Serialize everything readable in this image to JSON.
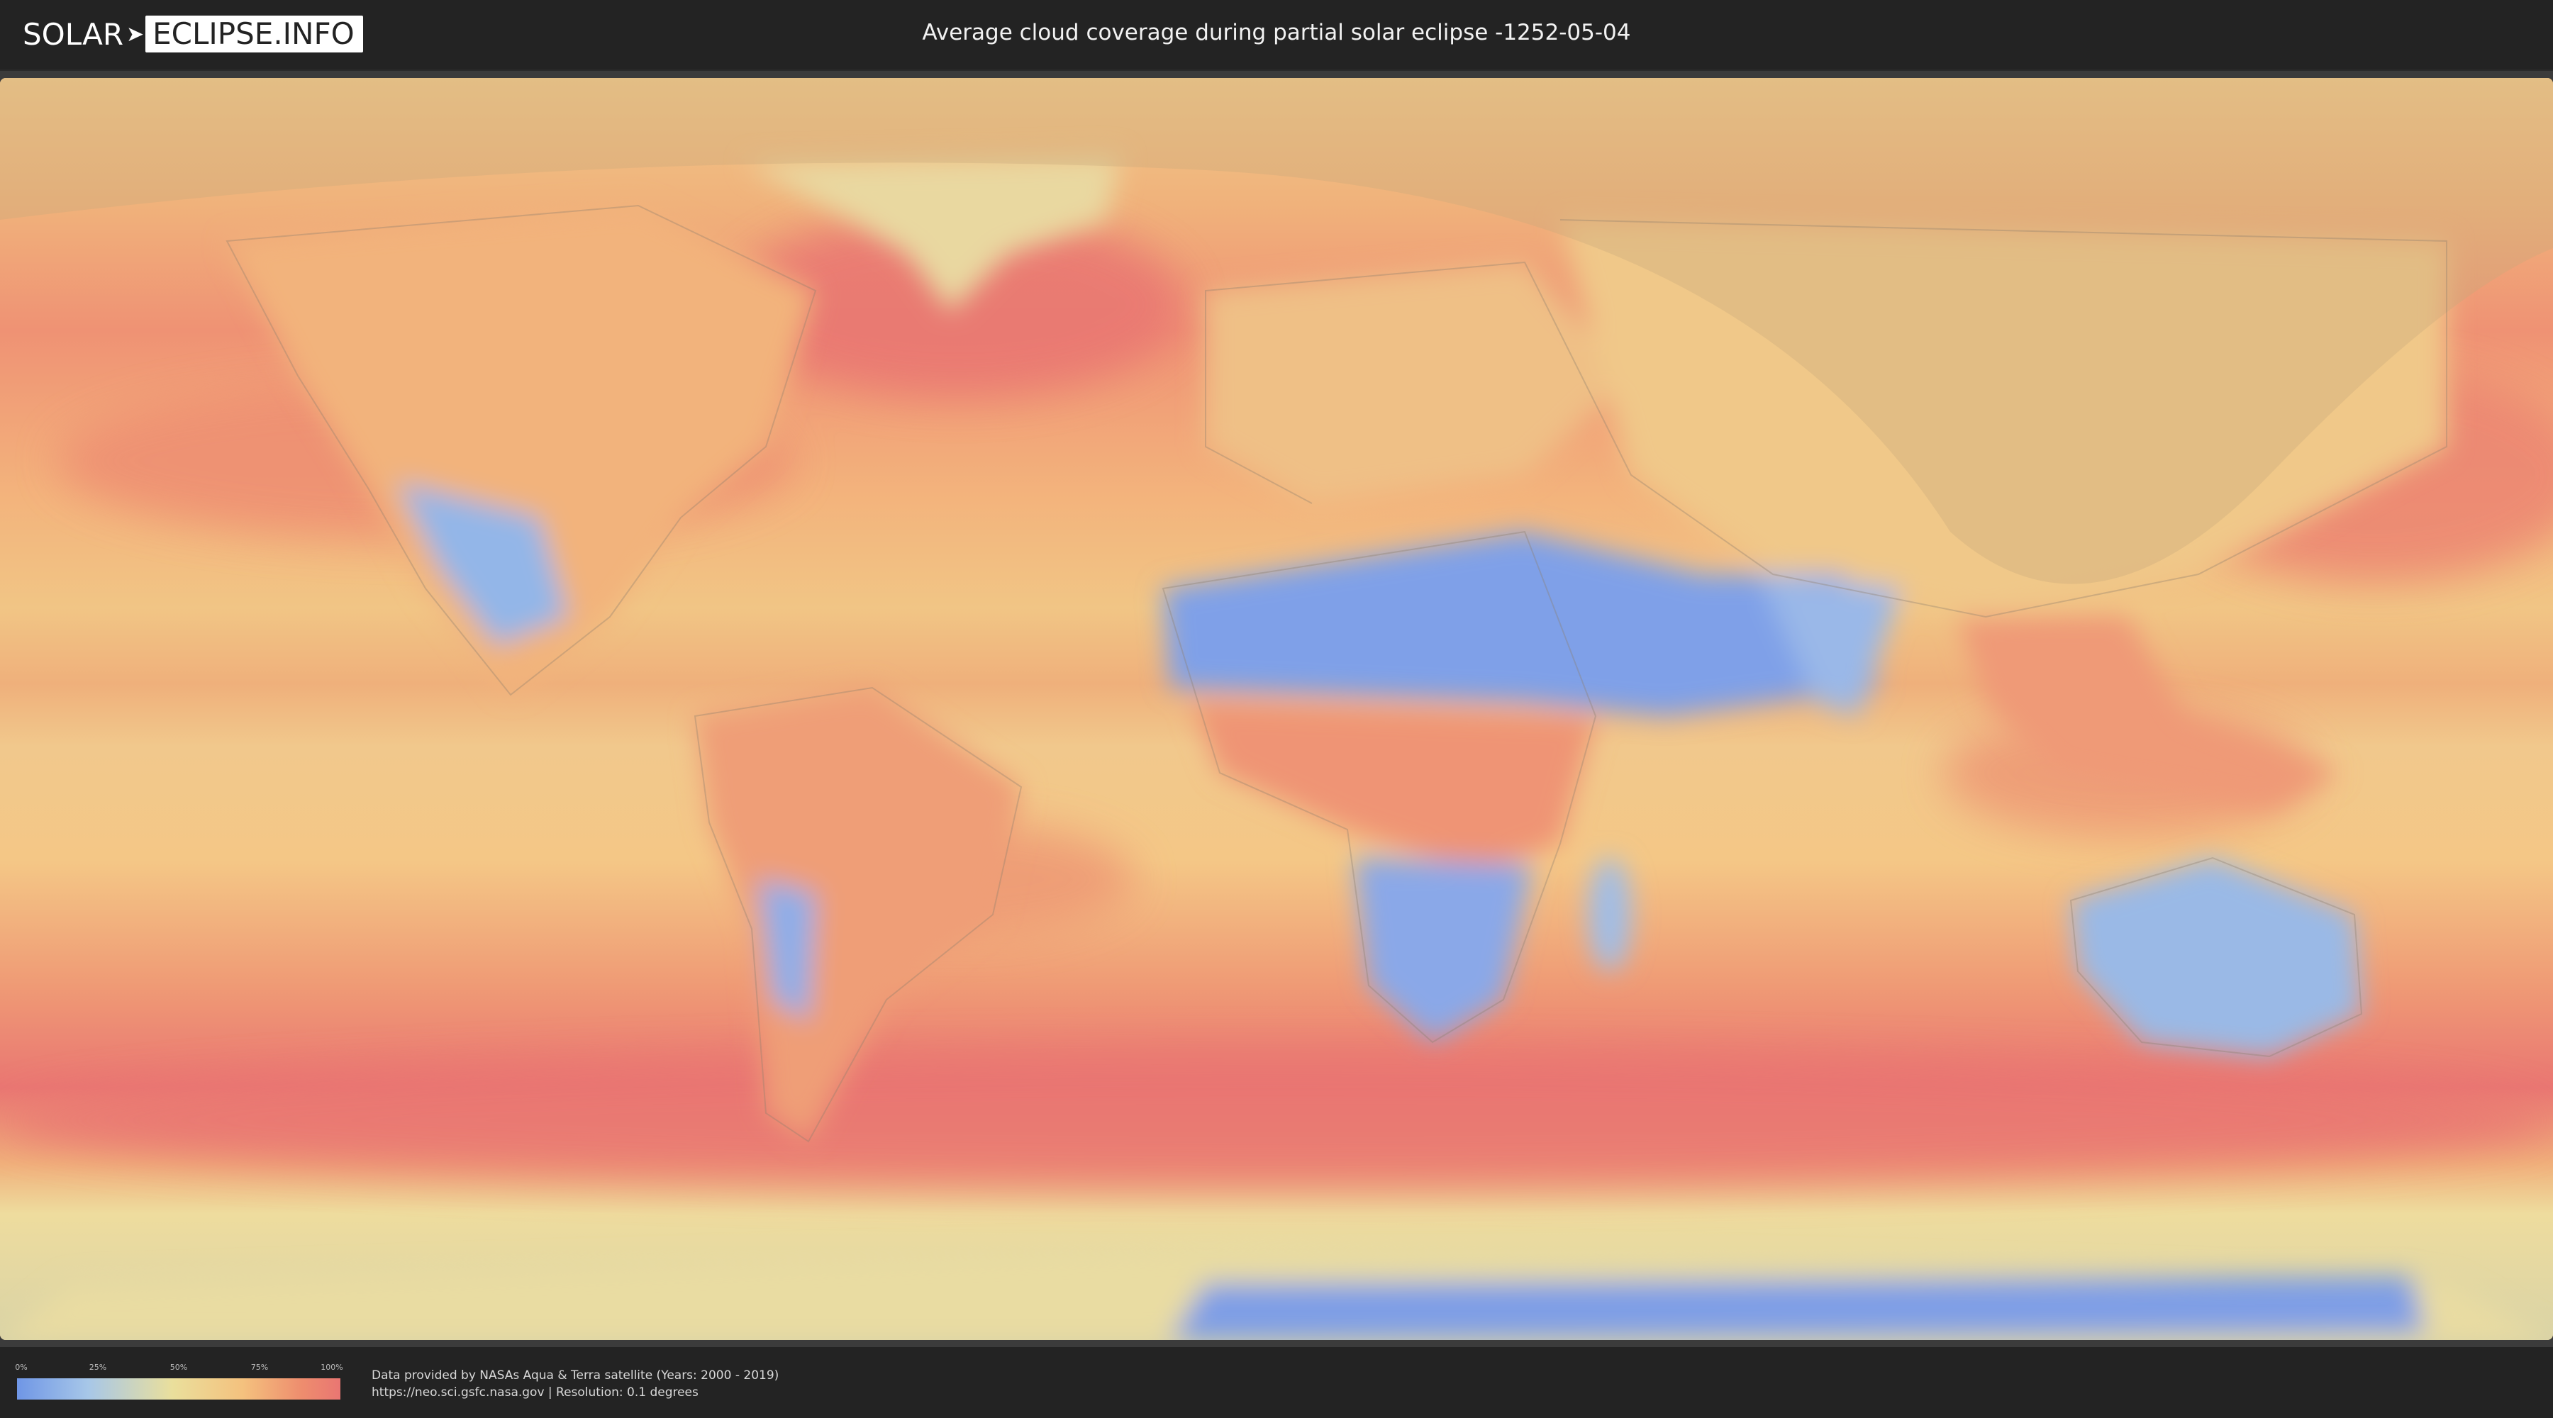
{
  "header": {
    "logo_part1": "SOLAR",
    "logo_part2": "ECLIPSE.INFO",
    "title": "Average cloud coverage during partial solar eclipse -1252-05-04"
  },
  "map": {
    "type": "world cloud coverage map",
    "projection": "equirectangular",
    "overlay": "eclipse visibility region (shaded)",
    "colors": {
      "clear": "#6f96e6",
      "low": "#a7c7e8",
      "mid": "#eadf9c",
      "high": "#f4c17e",
      "overcast": "#e97672"
    }
  },
  "legend": {
    "ticks": [
      "0%",
      "25%",
      "50%",
      "75%",
      "100%"
    ],
    "range_percent": [
      0,
      100
    ]
  },
  "footer": {
    "credit_line1": "Data provided by NASAs Aqua & Terra satellite (Years: 2000 - 2019)",
    "credit_line2": "https://neo.sci.gsfc.nasa.gov | Resolution: 0.1 degrees"
  }
}
